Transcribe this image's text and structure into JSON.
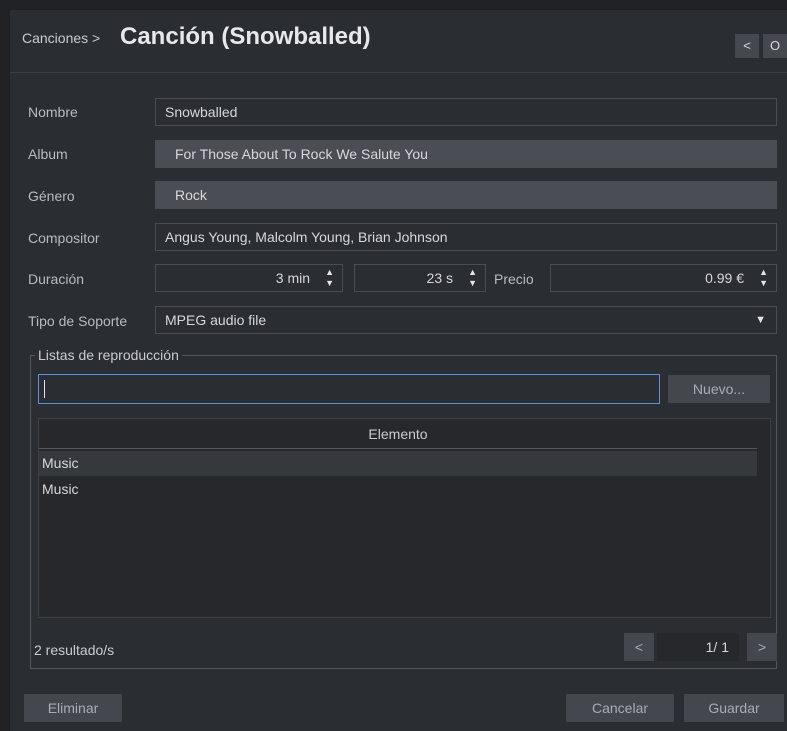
{
  "header": {
    "breadcrumb": "Canciones >",
    "title": "Canción (Snowballed)",
    "prev_label": "<",
    "next_label": "O"
  },
  "form": {
    "nombre_label": "Nombre",
    "nombre_value": "Snowballed",
    "album_label": "Album",
    "album_value": "For Those About To Rock We Salute You",
    "genero_label": "Género",
    "genero_value": "Rock",
    "compositor_label": "Compositor",
    "compositor_value": "Angus Young, Malcolm Young, Brian Johnson",
    "duracion_label": "Duración",
    "duracion_min": "3 min",
    "duracion_sec": "23 s",
    "precio_label": "Precio",
    "precio_value": "0.99 €",
    "tipo_label": "Tipo de Soporte",
    "tipo_value": "MPEG audio file"
  },
  "playlists": {
    "group_title": "Listas de reproducción",
    "search_value": "",
    "new_button": "Nuevo...",
    "column_header": "Elemento",
    "rows": [
      "Music",
      "Music"
    ],
    "results_text": "2 resultado/s",
    "page_prev": "<",
    "page_text": "1/ 1",
    "page_next": ">"
  },
  "footer": {
    "delete_label": "Eliminar",
    "cancel_label": "Cancelar",
    "save_label": "Guardar"
  },
  "colors": {
    "background": "#1f2125",
    "panel": "#2a2d32",
    "focus": "#5d8fdb"
  }
}
